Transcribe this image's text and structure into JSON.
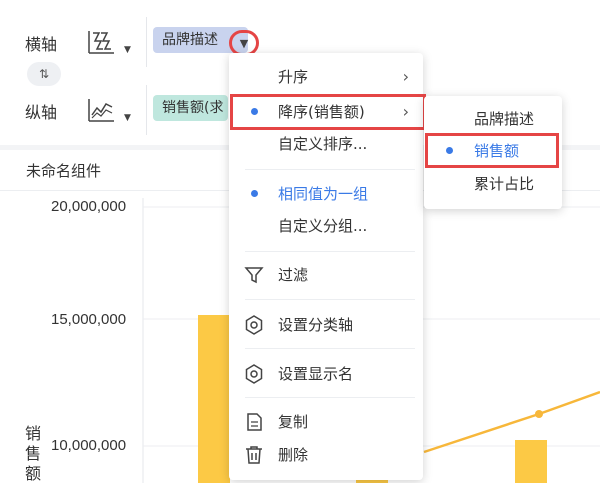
{
  "x_axis": {
    "label": "横轴",
    "chart_type_icon": "column-chart-icon",
    "field": "品牌描述"
  },
  "swap_icon": "swap-axes-icon",
  "y_axis": {
    "label": "纵轴",
    "chart_type_icon": "line-chart-icon",
    "field": "销售额(求"
  },
  "widget_title": "未命名组件",
  "chart": {
    "ylabel": "销售额",
    "ticks": [
      "20,000,000",
      "15,000,000",
      "10,000,000"
    ],
    "bar_color": "#fcc945",
    "line_color": "#f7b73a"
  },
  "menu": {
    "items": [
      {
        "label": "升序",
        "chevron": "›"
      },
      {
        "label": "降序(销售额)",
        "chevron": "›",
        "selected": true
      },
      {
        "label": "自定义排序..."
      },
      {
        "label": "相同值为一组",
        "selected": true
      },
      {
        "label": "自定义分组..."
      },
      {
        "label": "过滤",
        "icon": "filter-icon"
      },
      {
        "label": "设置分类轴",
        "icon": "gear-icon"
      },
      {
        "label": "设置显示名",
        "icon": "gear-icon"
      },
      {
        "label": "复制",
        "icon": "copy-icon"
      },
      {
        "label": "删除",
        "icon": "trash-icon"
      }
    ]
  },
  "submenu": {
    "items": [
      {
        "label": "品牌描述"
      },
      {
        "label": "销售额",
        "selected": true
      },
      {
        "label": "累计占比"
      }
    ]
  },
  "colors": {
    "accent": "#3a7ae6",
    "highlight": "#e54545",
    "x_pill": "#c9d3ee",
    "y_pill": "#bfe7de"
  }
}
